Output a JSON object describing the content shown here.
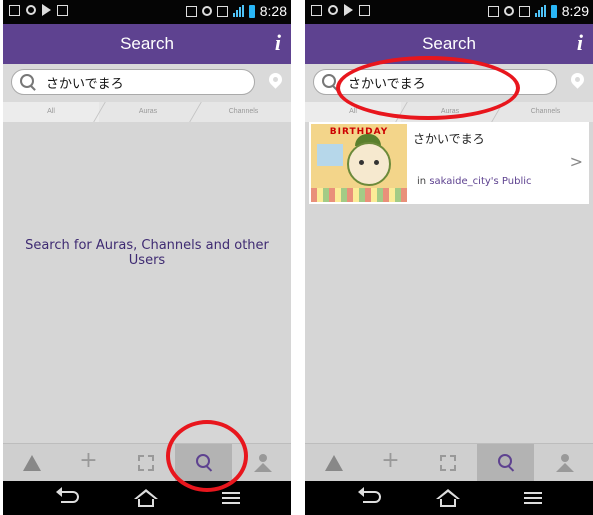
{
  "left_screen": {
    "status_bar": {
      "time": "8:28"
    },
    "header": {
      "title": "Search",
      "info_label": "i"
    },
    "search": {
      "value": "さかいでまろ"
    },
    "tabs": [
      "All",
      "Auras",
      "Channels"
    ],
    "empty_message": "Search for Auras, Channels and other Users"
  },
  "right_screen": {
    "status_bar": {
      "time": "8:29"
    },
    "header": {
      "title": "Search",
      "info_label": "i"
    },
    "search": {
      "value": "さかいでまろ"
    },
    "tabs": [
      "All",
      "Auras",
      "Channels"
    ],
    "result": {
      "thumbnail_banner": "BIRTHDAY",
      "title": "さかいでまろ",
      "in_label": "in",
      "channel": "sakaide_city's Public",
      "chevron": ">"
    }
  },
  "bottom_nav": {
    "items": [
      "auras-pyramid-icon",
      "add-plus-icon",
      "scan-frame-icon",
      "search-icon",
      "profile-person-icon"
    ],
    "plus_glyph": "+",
    "active_index": 3
  },
  "colors": {
    "header_purple": "#5e4290",
    "background_gray": "#d6d6d6",
    "annotation_red": "#e8161d"
  }
}
